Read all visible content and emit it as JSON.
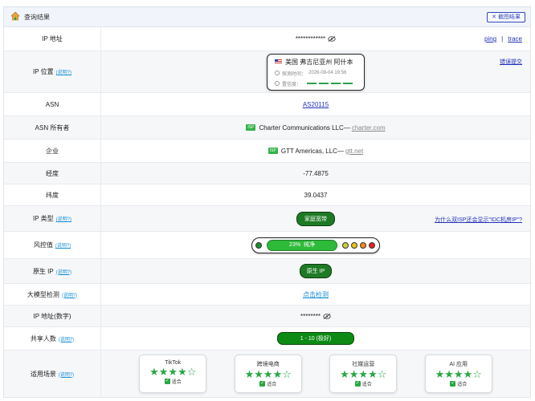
{
  "header": {
    "title": "查询结果",
    "shot_label": "截图结果"
  },
  "rows": {
    "ip": {
      "label": "IP 地址",
      "value": "************",
      "ping": "ping",
      "sep": "|",
      "trace": "trace"
    },
    "location": {
      "label": "IP 位置",
      "help": "(说明?)",
      "country": "美国 弗吉尼亚州 阿什本",
      "time_label": "探测时间：",
      "time": "2026-08-04 19:56",
      "conf_label": "置信度：",
      "report": "错误提交"
    },
    "asn": {
      "label": "ASN",
      "value": "AS20115"
    },
    "asn_owner": {
      "label": "ASN 所有者",
      "tag": "ISP",
      "name": "Charter Communications LLC",
      "dash": "—",
      "domain": "charter.com"
    },
    "org": {
      "label": "企业",
      "tag": "ISP",
      "name": "GTT Americas, LLC",
      "dash": "—",
      "domain": "gtt.net"
    },
    "lon": {
      "label": "经度",
      "value": "-77.4875"
    },
    "lat": {
      "label": "纬度",
      "value": "39.0437"
    },
    "iptype": {
      "label": "IP 类型",
      "help": "(说明?)",
      "value": "家庭宽带",
      "why": "为什么双ISP还会显示\"IDC机房IP\"?"
    },
    "risk": {
      "label": "风控值",
      "help": "(说明?)",
      "percent": "23%",
      "text": "纯净"
    },
    "native": {
      "label": "原生 IP",
      "help": "(说明?)",
      "value": "原生 IP"
    },
    "llm": {
      "label": "大模型检测",
      "help": "(说明?)",
      "value": "点击检测"
    },
    "ipnum": {
      "label": "IP 地址(数字)",
      "value": "********"
    },
    "share": {
      "label": "共享人数",
      "help": "(说明?)",
      "value": "1 - 10 (极好)"
    },
    "scene": {
      "label": "适用场景",
      "help": "(说明?)"
    }
  },
  "scenes": [
    {
      "name": "TikTok",
      "stars": "★★★★☆",
      "status": "适合"
    },
    {
      "name": "跨境电商",
      "stars": "★★★★☆",
      "status": "适合"
    },
    {
      "name": "社媒运营",
      "stars": "★★★★☆",
      "status": "适合"
    },
    {
      "name": "AI 应用",
      "stars": "★★★★☆",
      "status": "适合"
    }
  ],
  "colors": {
    "accent": "#2231b8",
    "green": "#1e7a25",
    "help": "#1a8fd6",
    "risk_dots": [
      "#1f8f2a",
      "#c7d23a",
      "#e8c21c",
      "#f08a1c",
      "#e02424"
    ]
  }
}
